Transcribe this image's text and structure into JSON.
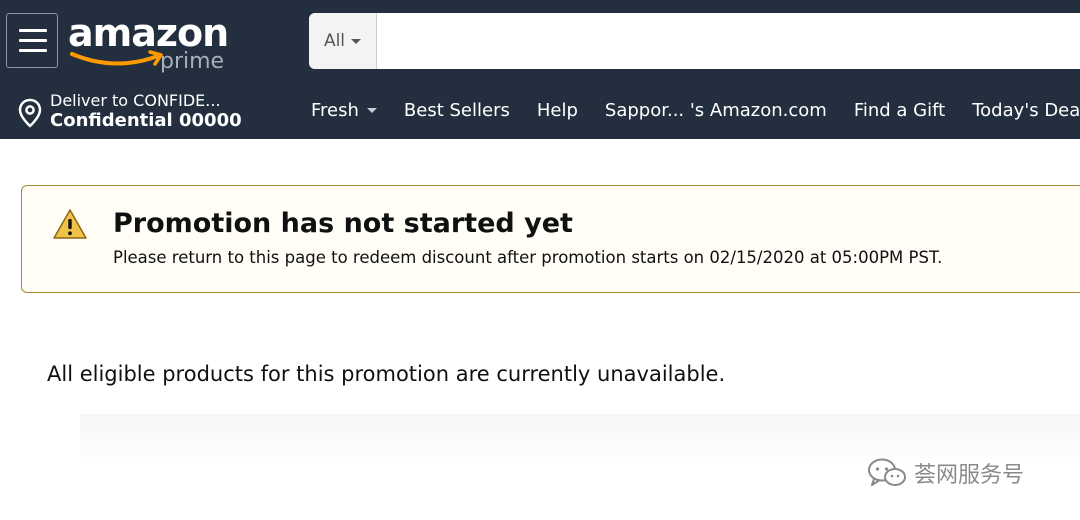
{
  "header": {
    "logo": {
      "word": "amazon",
      "sub": "prime"
    },
    "search": {
      "category": "All",
      "value": "",
      "placeholder": ""
    }
  },
  "nav": {
    "deliver": {
      "line1": "Deliver to CONFIDE...",
      "line2": "Confidential 00000"
    },
    "links": [
      {
        "label": "Fresh",
        "has_dropdown": true
      },
      {
        "label": "Best Sellers"
      },
      {
        "label": "Help"
      },
      {
        "label": "Sappor...  's Amazon.com"
      },
      {
        "label": "Find a Gift"
      },
      {
        "label": "Today's Deals"
      }
    ]
  },
  "alert": {
    "icon": "warning-icon",
    "title": "Promotion has not started yet",
    "text": "Please return to this page to redeem discount after promotion starts on 02/15/2020 at 05:00PM PST."
  },
  "main": {
    "message": "All eligible products for this promotion are currently unavailable."
  },
  "watermark": {
    "text": "荟网服务号",
    "icon": "wechat-icon"
  },
  "colors": {
    "header_bg": "#232f3e",
    "logo_smile": "#ff9900",
    "alert_border": "#a88734",
    "warning_yellow": "#f0c14b"
  }
}
